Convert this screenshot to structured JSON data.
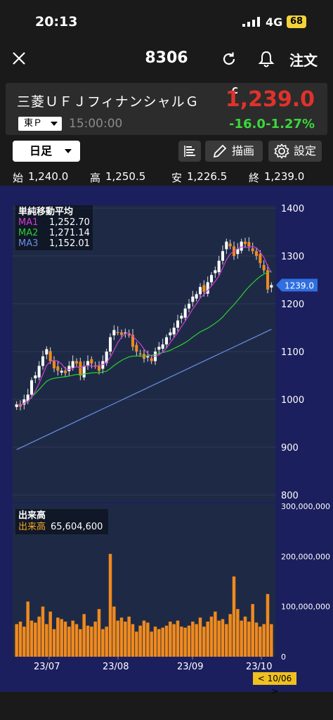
{
  "status_bar": {
    "time": "20:13",
    "network": "4G",
    "battery": "68"
  },
  "nav": {
    "title": "8306",
    "order_label": "注文"
  },
  "quote": {
    "name": "三菱ＵＦＪフィナンシャルＧ",
    "flag": "C",
    "price": "1,239.0",
    "exchange": "東Ｐ",
    "time": "15:00:00",
    "change": "-16.0",
    "change_pct": "-1.27%"
  },
  "toolbar": {
    "timeframe": "日足",
    "draw_label": "描画",
    "settings_label": "設定"
  },
  "ohlc": {
    "open_label": "始",
    "open": "1,240.0",
    "high_label": "高",
    "high": "1,250.5",
    "low_label": "安",
    "low": "1,226.5",
    "close_label": "終",
    "close": "1,239.0"
  },
  "ma_legend": {
    "title": "単純移動平均",
    "items": [
      {
        "label": "MA1",
        "value": "1,252.70",
        "color": "#d23cd2"
      },
      {
        "label": "MA2",
        "value": "1,271.14",
        "color": "#2ed02e"
      },
      {
        "label": "MA3",
        "value": "1,152.01",
        "color": "#6a8ee6"
      }
    ]
  },
  "volume_legend": {
    "title": "出来高",
    "label": "出来高",
    "value": "65,604,600",
    "color": "#f5a623"
  },
  "price_axis": {
    "ticks": [
      "1400",
      "1300",
      "1200",
      "1100",
      "1000",
      "900",
      "800"
    ]
  },
  "current_price_tag": "1239.0",
  "volume_axis": {
    "ticks": [
      "300,000,000",
      "200,000,000",
      "100,000,000",
      "0"
    ]
  },
  "date_axis": {
    "ticks": [
      "23/07",
      "23/08",
      "23/09",
      "23/10"
    ]
  },
  "date_badge": "< 10/06 >",
  "colors": {
    "up": "#ffffff",
    "down": "#f08a1e",
    "background": "#1c1f5e",
    "price_red": "#e0322c",
    "change_green": "#3cd63c"
  },
  "chart_data": {
    "type": "candlestick",
    "ylim": [
      800,
      1400
    ],
    "volume_ylim": [
      0,
      300000000
    ],
    "closes": [
      990,
      985,
      1000,
      1010,
      1040,
      1050,
      1070,
      1090,
      1105,
      1080,
      1065,
      1060,
      1060,
      1055,
      1070,
      1080,
      1075,
      1050,
      1070,
      1080,
      1075,
      1070,
      1060,
      1080,
      1100,
      1130,
      1145,
      1140,
      1135,
      1140,
      1135,
      1110,
      1100,
      1095,
      1085,
      1090,
      1080,
      1100,
      1110,
      1115,
      1130,
      1140,
      1150,
      1165,
      1175,
      1190,
      1200,
      1215,
      1220,
      1235,
      1225,
      1245,
      1260,
      1270,
      1290,
      1310,
      1330,
      1320,
      1300,
      1315,
      1330,
      1325,
      1320,
      1310,
      1300,
      1285,
      1270,
      1230,
      1239
    ],
    "volumes": [
      65,
      70,
      60,
      110,
      72,
      68,
      80,
      100,
      65,
      90,
      55,
      78,
      75,
      70,
      60,
      72,
      65,
      55,
      85,
      62,
      60,
      70,
      95,
      55,
      60,
      205,
      100,
      72,
      78,
      70,
      80,
      65,
      50,
      62,
      72,
      68,
      50,
      60,
      55,
      58,
      62,
      70,
      65,
      72,
      60,
      58,
      62,
      70,
      65,
      78,
      60,
      70,
      80,
      90,
      72,
      75,
      65,
      85,
      160,
      95,
      72,
      80,
      70,
      105,
      68,
      60,
      65,
      125,
      65
    ]
  }
}
